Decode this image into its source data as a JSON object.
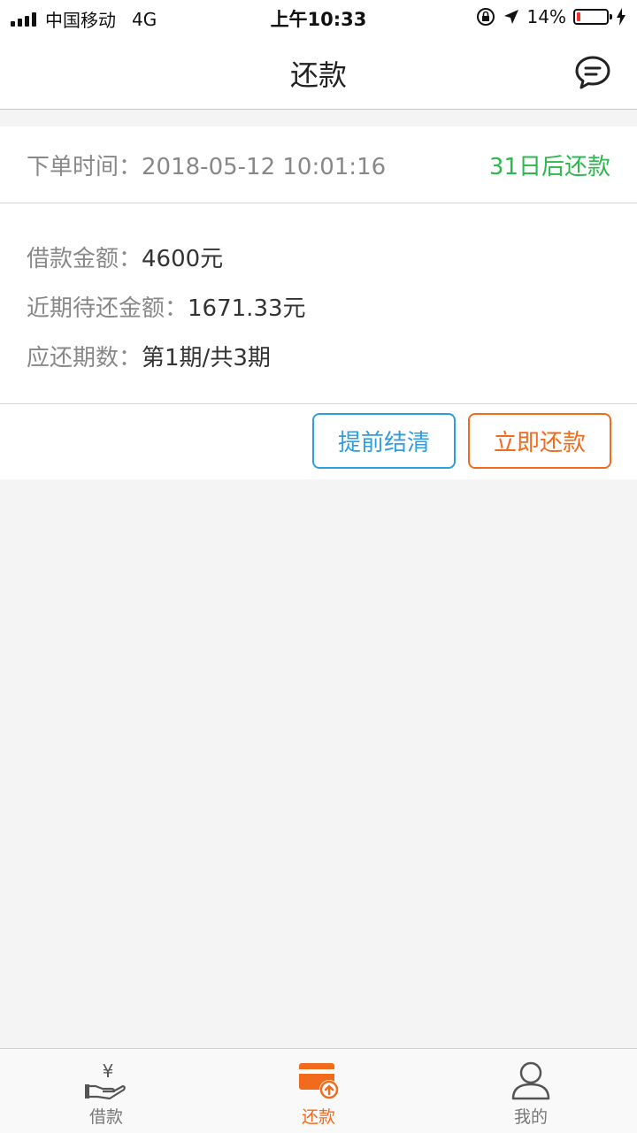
{
  "status_bar": {
    "carrier": "中国移动",
    "network": "4G",
    "time": "上午10:33",
    "battery": "14%",
    "battery_level": 0.14
  },
  "nav": {
    "title": "还款",
    "message_icon": "chat-bubble-icon"
  },
  "order": {
    "time_label": "下单时间：",
    "time_value": "2018-05-12 10:01:16",
    "due_text": "31日后还款"
  },
  "details": {
    "loan_amount_label": "借款金额：",
    "loan_amount_value": "4600元",
    "pending_label": "近期待还金额：",
    "pending_value": "1671.33元",
    "period_label": "应还期数：",
    "period_value": "第1期/共3期"
  },
  "actions": {
    "early_settle": "提前结清",
    "repay_now": "立即还款"
  },
  "colors": {
    "due_green": "#2db84d",
    "accent_orange": "#f26b1d",
    "accent_blue": "#2f9ee0"
  },
  "tabs": [
    {
      "label": "借款",
      "icon": "yen-hand-icon"
    },
    {
      "label": "还款",
      "icon": "card-repay-icon",
      "active": true
    },
    {
      "label": "我的",
      "icon": "user-icon"
    }
  ]
}
